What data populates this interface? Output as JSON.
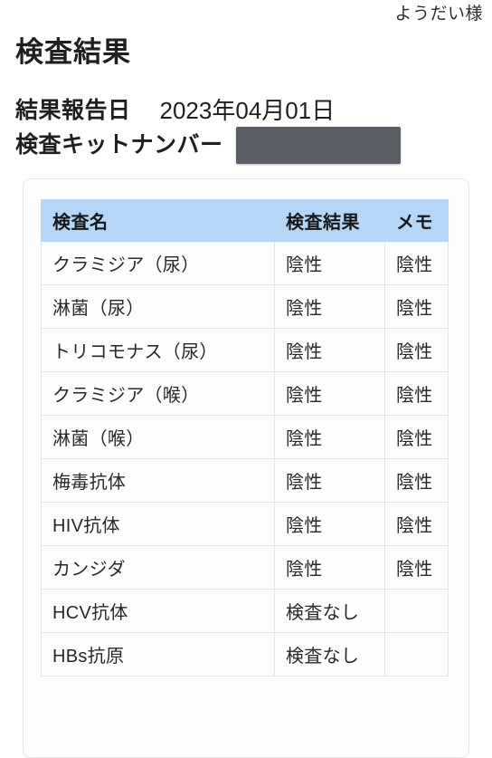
{
  "header": {
    "greeting": "ようだい様"
  },
  "page": {
    "title": "検査結果"
  },
  "meta": {
    "report_date_label": "結果報告日",
    "report_date_value": "2023年04月01日",
    "kit_number_label": "検査キットナンバー",
    "kit_number_value": ""
  },
  "table": {
    "columns": [
      {
        "key": "name",
        "label": "検査名"
      },
      {
        "key": "result",
        "label": "検査結果"
      },
      {
        "key": "memo",
        "label": "メモ"
      }
    ],
    "rows": [
      {
        "name": "クラミジア（尿）",
        "result": "陰性",
        "memo": "陰性"
      },
      {
        "name": "淋菌（尿）",
        "result": "陰性",
        "memo": "陰性"
      },
      {
        "name": "トリコモナス（尿）",
        "result": "陰性",
        "memo": "陰性"
      },
      {
        "name": "クラミジア（喉）",
        "result": "陰性",
        "memo": "陰性"
      },
      {
        "name": "淋菌（喉）",
        "result": "陰性",
        "memo": "陰性"
      },
      {
        "name": "梅毒抗体",
        "result": "陰性",
        "memo": "陰性"
      },
      {
        "name": "HIV抗体",
        "result": "陰性",
        "memo": "陰性"
      },
      {
        "name": "カンジダ",
        "result": "陰性",
        "memo": "陰性"
      },
      {
        "name": "HCV抗体",
        "result": "検査なし",
        "memo": ""
      },
      {
        "name": "HBs抗原",
        "result": "検査なし",
        "memo": ""
      }
    ]
  },
  "colors": {
    "table_header_bg": "#b5d7f7",
    "redaction": "#5a5d63",
    "border": "#e3e5e7",
    "text": "#26282a"
  }
}
